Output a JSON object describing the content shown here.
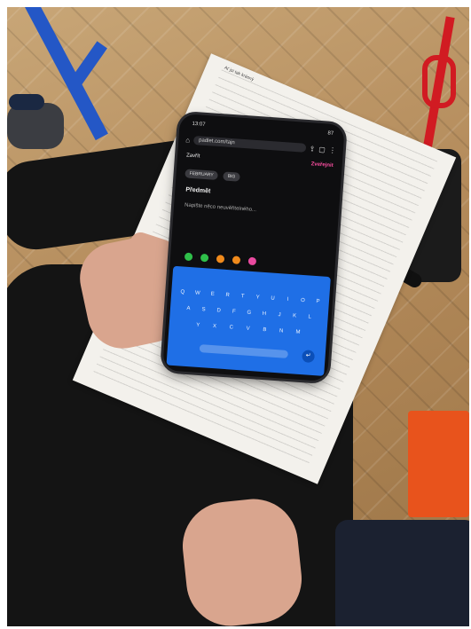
{
  "paper": {
    "title": "Ať jsi tak krásný"
  },
  "phone": {
    "status": {
      "time": "13:07",
      "battery": "87"
    },
    "browser": {
      "url": "padlet.com/tajn"
    },
    "padlet": {
      "close_label": "Zavřít",
      "publish_label": "Zveřejnit",
      "chip_1": "FEBRUARY",
      "chip_2": "BIG",
      "subject_placeholder": "Předmět",
      "body_placeholder": "Napište něco neuvěřitelného..."
    },
    "attachment_colors": [
      "#2fbf4a",
      "#2fbf4a",
      "#f08a1c",
      "#f08a1c",
      "#e94aa0"
    ],
    "keyboard": {
      "row1": [
        "Q",
        "W",
        "E",
        "R",
        "T",
        "Y",
        "U",
        "I",
        "O",
        "P"
      ],
      "row2": [
        "A",
        "S",
        "D",
        "F",
        "G",
        "H",
        "J",
        "K",
        "L"
      ],
      "row3": [
        "Y",
        "X",
        "C",
        "V",
        "B",
        "N",
        "M"
      ]
    }
  }
}
